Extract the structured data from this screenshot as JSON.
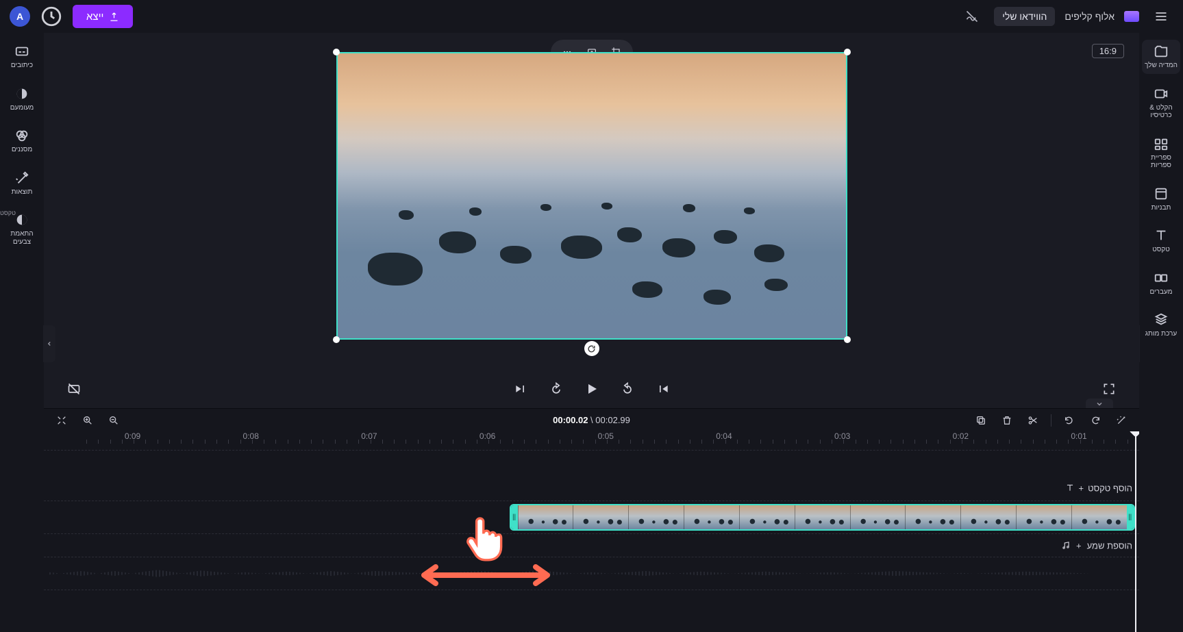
{
  "top": {
    "project_name": "אלוף קליפים",
    "my_video": "הווידאו שלי",
    "export": "ייצא",
    "avatar_initial": "A"
  },
  "sidebar_right": {
    "items": [
      {
        "label": "המדיה שלך"
      },
      {
        "label": "הקלט &amp; כרטיסיו"
      },
      {
        "label": "ספריית ספריות"
      },
      {
        "label": "תבניות"
      },
      {
        "label": "טקסט"
      },
      {
        "label": "מעברים"
      },
      {
        "label": "ערכת מותג"
      }
    ]
  },
  "sidebar_left": {
    "items": [
      {
        "label": "כיתובים"
      },
      {
        "label": "מעומעם"
      },
      {
        "label": "מסננים"
      },
      {
        "label": "תוצאות"
      },
      {
        "label": "התאמת צבעים"
      },
      {
        "label_small": "טקסט"
      }
    ]
  },
  "stage": {
    "fit_label": "16:9"
  },
  "timeline": {
    "timecode_current": "00:00.02",
    "timecode_total": "00:02.99",
    "ruler": [
      "0:01",
      "0:02",
      "0:03",
      "0:04",
      "0:05",
      "0:06",
      "0:07",
      "0:08",
      "0:09"
    ],
    "add_text": "הוסף טקסט",
    "add_audio": "הוספת שמע"
  }
}
